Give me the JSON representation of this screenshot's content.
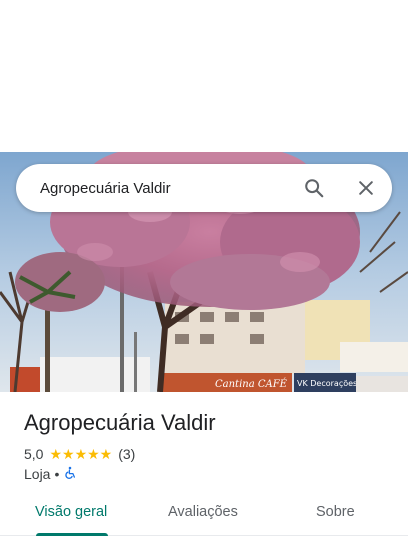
{
  "search": {
    "value": "Agropecuária Valdir"
  },
  "place": {
    "name": "Agropecuária Valdir",
    "rating": "5,0",
    "stars": "★★★★★",
    "review_count": "(3)",
    "category": "Loja",
    "separator": "•"
  },
  "photo": {
    "sign_left": "Cantina CAFÉ",
    "sign_right": "VK Decorações"
  },
  "tabs": [
    {
      "label": "Visão geral",
      "active": true
    },
    {
      "label": "Avaliações",
      "active": false
    },
    {
      "label": "Sobre",
      "active": false
    }
  ],
  "icons": {
    "search": "search-icon",
    "close": "close-icon",
    "accessibility": "wheelchair-icon"
  },
  "colors": {
    "accent": "#00796b",
    "star": "#fbbc04",
    "accessibility": "#1a73e8"
  }
}
